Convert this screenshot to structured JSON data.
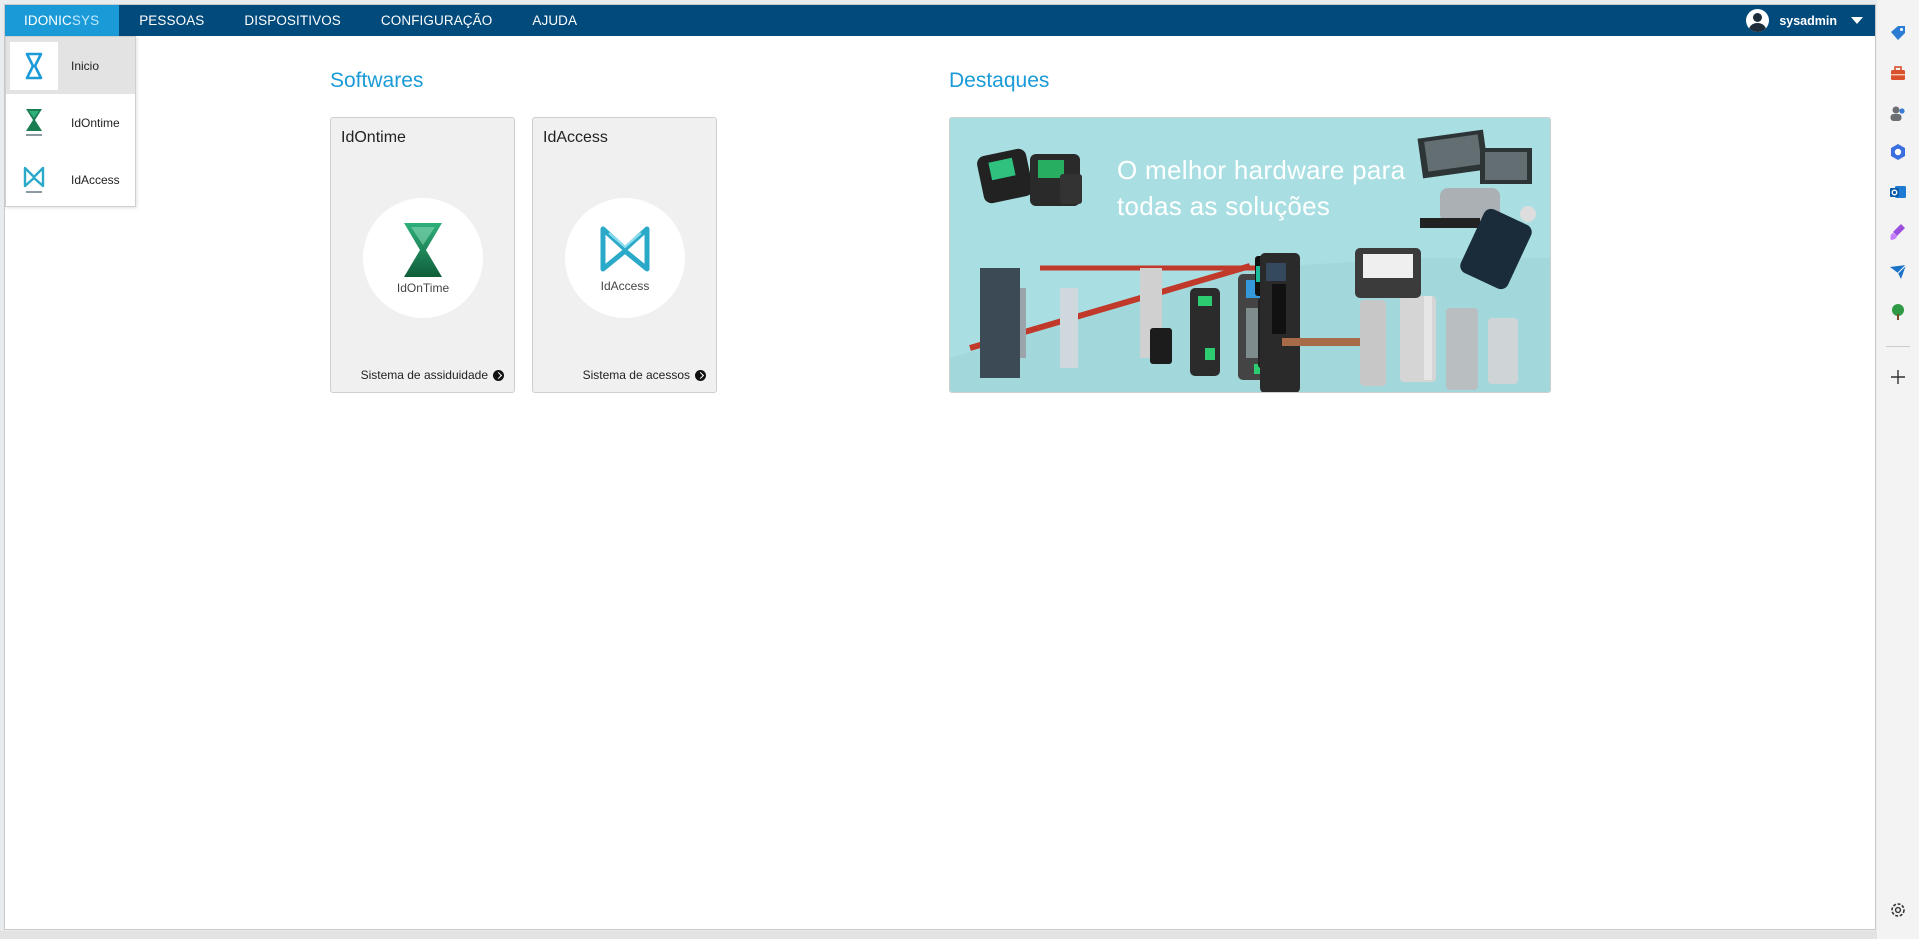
{
  "navbar": {
    "brand_a": "IDONIC",
    "brand_b": "SYS",
    "items": [
      "PESSOAS",
      "DISPOSITIVOS",
      "CONFIGURAÇÃO",
      "AJUDA"
    ],
    "username": "sysadmin"
  },
  "dropdown": {
    "items": [
      {
        "label": "Inicio",
        "icon": "hourglass-outline-icon"
      },
      {
        "label": "IdOntime",
        "icon": "idontime-logo-icon"
      },
      {
        "label": "IdAccess",
        "icon": "idaccess-logo-icon"
      }
    ]
  },
  "softwares": {
    "title": "Softwares",
    "cards": [
      {
        "title": "IdOntime",
        "caption": "IdOnTime",
        "link": "Sistema de assiduidade"
      },
      {
        "title": "IdAccess",
        "caption": "IdAccess",
        "link": "Sistema de acessos"
      }
    ]
  },
  "destaques": {
    "title": "Destaques",
    "banner_text": "O melhor hardware para todas as soluções"
  },
  "colors": {
    "navbar": "#004a7c",
    "accent": "#1a9bd7",
    "banner_bg": "#a9dfe2"
  },
  "browser_sidebar": {
    "icons": [
      "tag-icon",
      "toolbox-icon",
      "people-icon",
      "copilot-icon",
      "outlook-icon",
      "brush-icon",
      "send-icon",
      "tree-icon",
      "add-icon",
      "settings-icon"
    ]
  }
}
